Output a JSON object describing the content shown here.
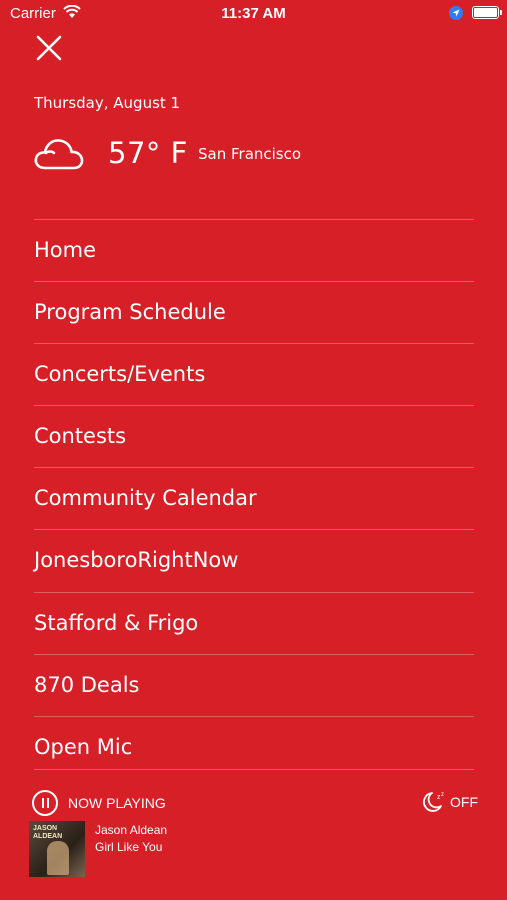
{
  "status_bar": {
    "carrier": "Carrier",
    "time": "11:37 AM"
  },
  "header": {
    "date": "Thursday, August 1"
  },
  "weather": {
    "icon": "cloud-icon",
    "temperature": "57° F",
    "city": "San Francisco"
  },
  "menu": {
    "items": [
      {
        "label": "Home"
      },
      {
        "label": "Program Schedule"
      },
      {
        "label": "Concerts/Events"
      },
      {
        "label": "Contests"
      },
      {
        "label": "Community Calendar"
      },
      {
        "label": "JonesboroRightNow"
      },
      {
        "label": "Stafford & Frigo"
      },
      {
        "label": "870 Deals"
      },
      {
        "label": "Open Mic"
      }
    ]
  },
  "player": {
    "now_playing_label": "NOW PLAYING",
    "sleep_timer_label": "OFF",
    "artist": "Jason Aldean",
    "song": "Girl Like You",
    "album_art_text": "JASON ALDEAN"
  },
  "colors": {
    "background": "#d61f26",
    "text": "#ffffff"
  }
}
